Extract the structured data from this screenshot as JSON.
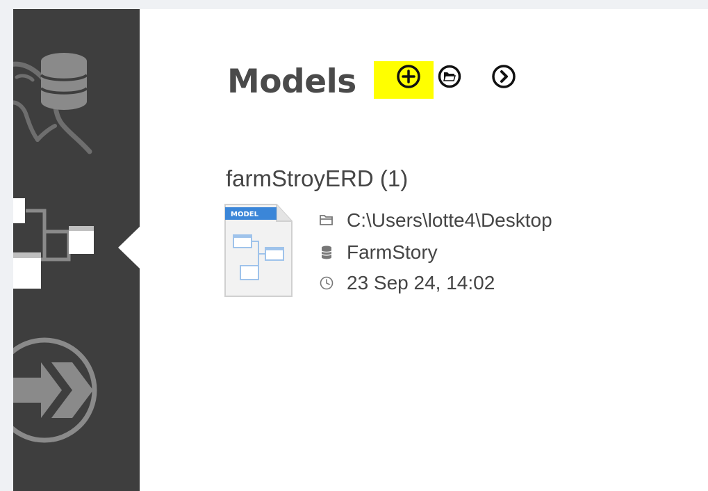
{
  "header": {
    "title": "Models",
    "actions": [
      {
        "id": "add",
        "icon": "plus-circle-icon",
        "highlighted": true
      },
      {
        "id": "open",
        "icon": "folder-circle-icon"
      },
      {
        "id": "more",
        "icon": "chevron-right-circle-icon"
      }
    ]
  },
  "sidebar": {
    "items": [
      {
        "id": "sql-development",
        "icon": "dolphin-database-icon",
        "active": false
      },
      {
        "id": "data-modeling",
        "icon": "diagram-icon",
        "active": true
      },
      {
        "id": "migration",
        "icon": "arrow-forward-circle-icon",
        "active": false
      }
    ]
  },
  "model": {
    "title": "farmStroyERD (1)",
    "thumbnail_label": "MODEL",
    "path": "C:\\Users\\lotte4\\Desktop",
    "schema": "FarmStory",
    "modified": "23 Sep 24, 14:02"
  },
  "colors": {
    "sidebar_bg": "#3e3e3e",
    "highlight": "#ffff00",
    "title_text": "#4a4a4a",
    "body_text": "#454545",
    "thumb_blue": "#3b86d8"
  }
}
